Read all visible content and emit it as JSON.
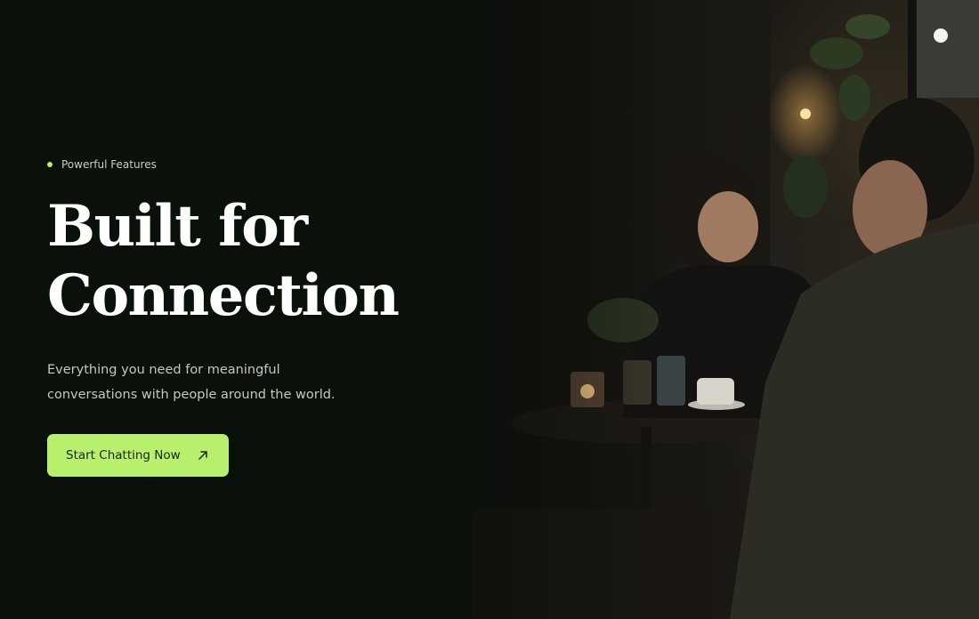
{
  "hero": {
    "eyebrow": "Powerful Features",
    "headline_line1": "Built for",
    "headline_line2": "Connection",
    "subtitle_line1": "Everything you need for meaningful",
    "subtitle_line2": "conversations with people around the world.",
    "cta_label": "Start Chatting Now",
    "cta_icon": "arrow-up-right-icon",
    "accent_color": "#b8f06e",
    "background_color": "#0a100a"
  }
}
